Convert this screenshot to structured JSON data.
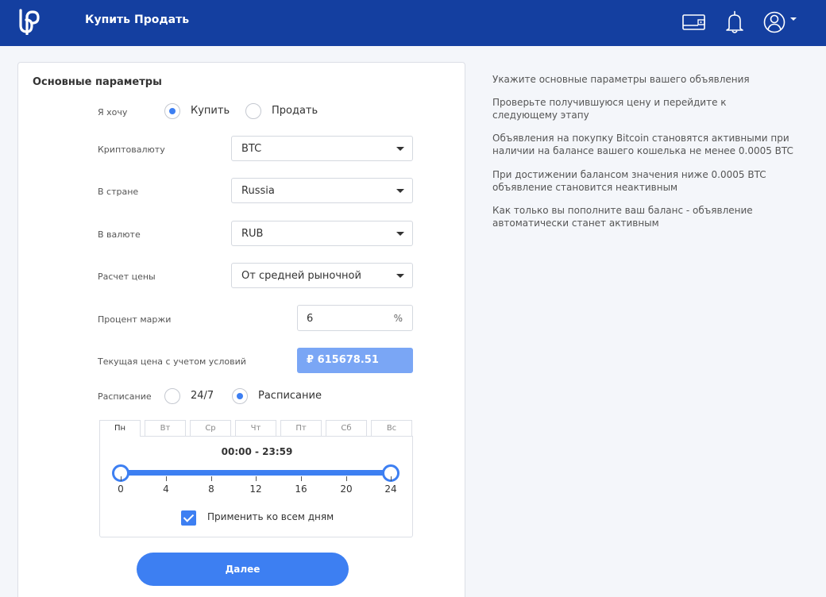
{
  "header": {
    "nav": [
      "Купить",
      "Продать"
    ],
    "icons": [
      "logo-icon",
      "wallet-icon",
      "bell-icon",
      "user-icon",
      "chevron-down-icon"
    ],
    "bg_color": "#143fa0"
  },
  "form": {
    "title": "Основные параметры",
    "want_label": "Я хочу",
    "want_options": [
      "Купить",
      "Продать"
    ],
    "want_selected": "Купить",
    "crypto_label": "Криптовалюту",
    "crypto_value": "BTC",
    "country_label": "В стране",
    "country_value": "Russia",
    "currency_label": "В валюте",
    "currency_value": "RUB",
    "pricing_label": "Расчет цены",
    "pricing_value": "От средней рыночной",
    "margin_label": "Процент маржи",
    "margin_value": "6",
    "margin_unit": "%",
    "price_label": "Текущая цена с учетом условий",
    "price_value": "₽ 615678.51",
    "schedule_label": "Расписание",
    "schedule_options": [
      "24/7",
      "Расписание"
    ],
    "schedule_selected": "Расписание",
    "days": [
      "Пн",
      "Вт",
      "Ср",
      "Чт",
      "Пт",
      "Сб",
      "Вс"
    ],
    "active_day": "Пн",
    "time_range": "00:00 - 23:59",
    "slider_ticks": [
      "0",
      "4",
      "8",
      "12",
      "16",
      "20",
      "24"
    ],
    "apply_all_label": "Применить ко всем дням",
    "apply_all_checked": true,
    "next_label": "Далее",
    "accent_color": "#3d7ff2"
  },
  "hints": [
    "Укажите основные параметры вашего объявления",
    "Проверьте получившуюся цену и перейдите к следующему этапу",
    "Объявления на покупку Bitcoin становятся активными при наличии на балансе вашего кошелька не менее 0.0005 BTC",
    "При достижении балансом значения ниже 0.0005 BTC объявление становится неактивным",
    "Как только вы пополните ваш баланс - объявление автоматически станет активным"
  ]
}
